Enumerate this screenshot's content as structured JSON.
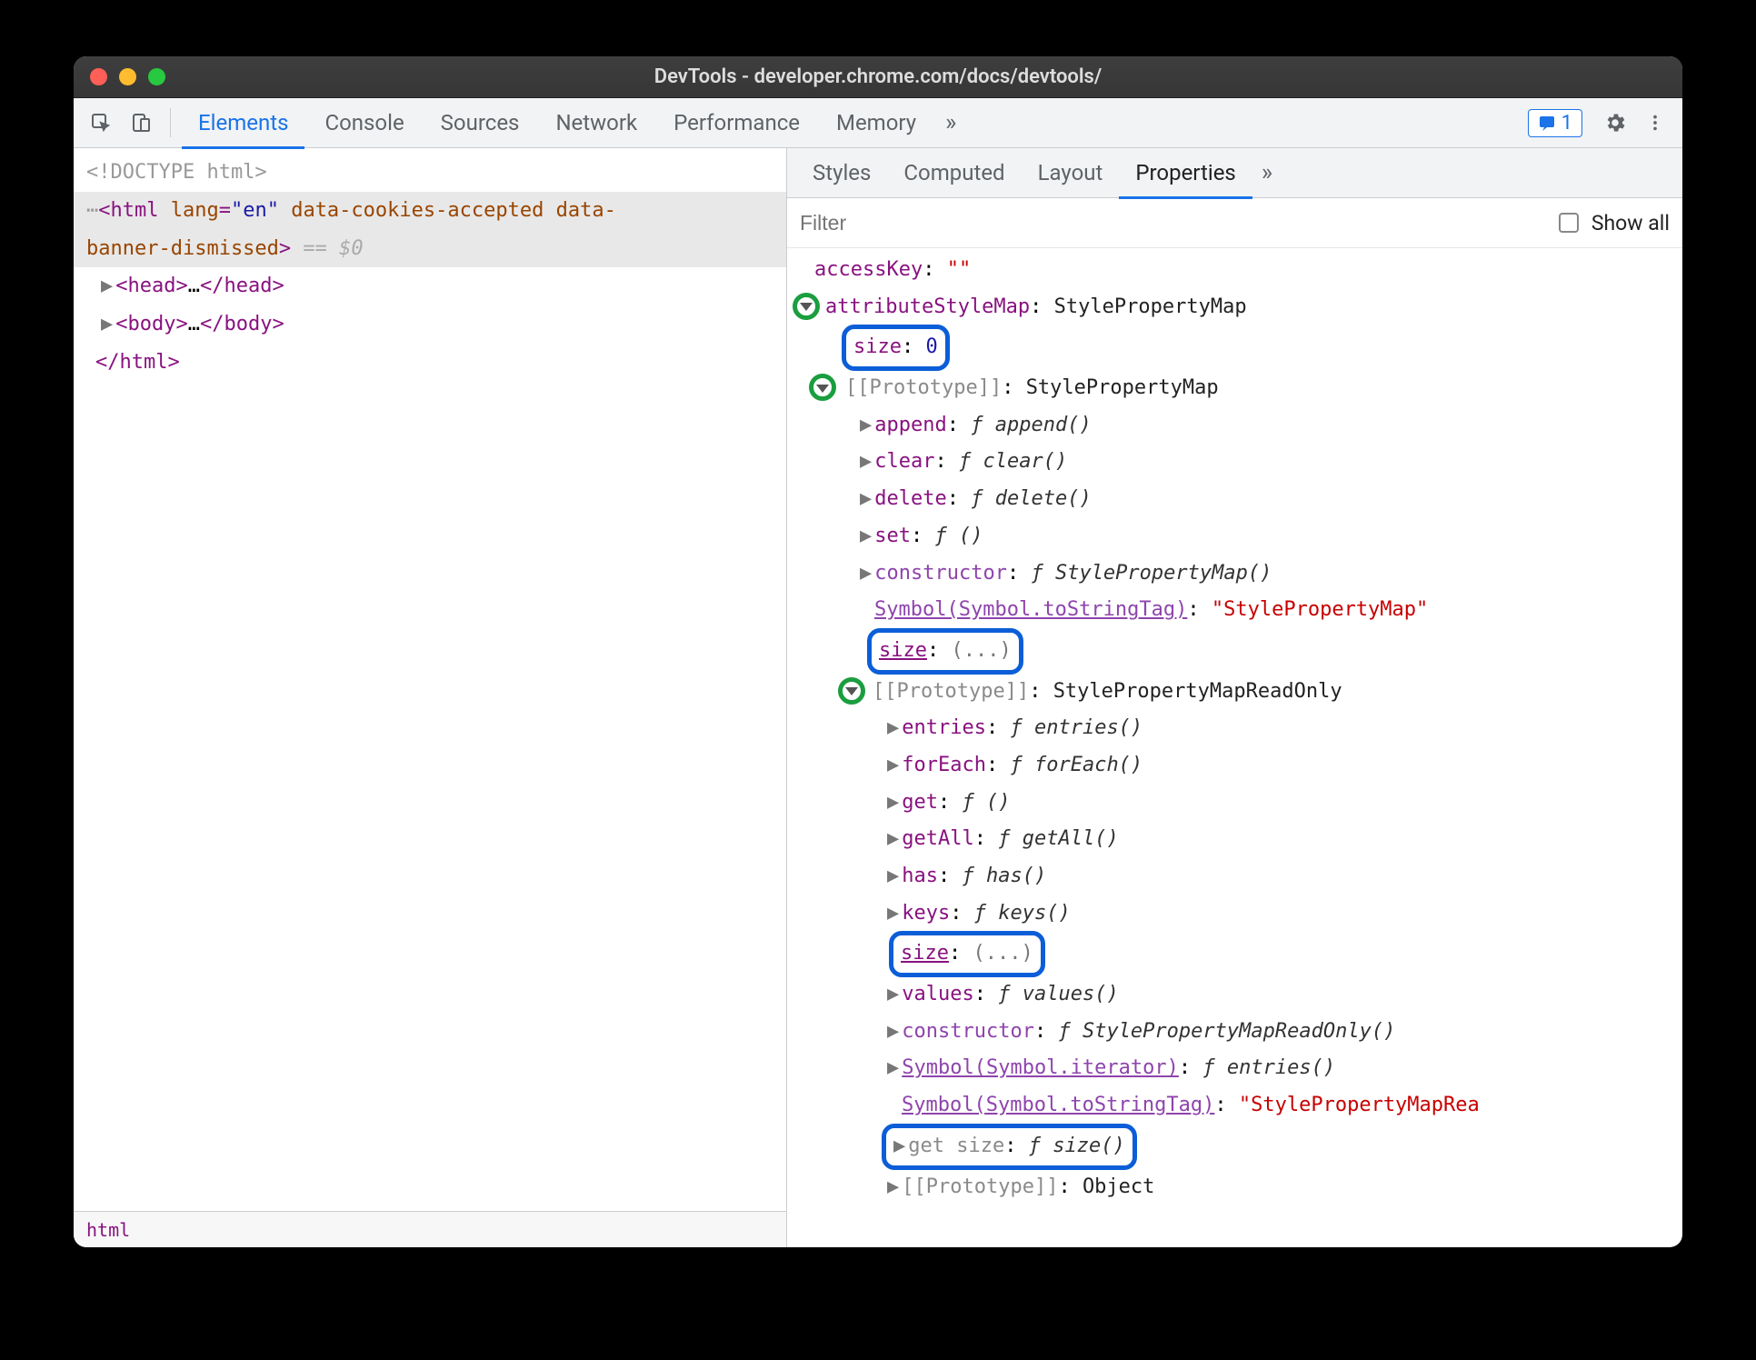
{
  "window": {
    "title": "DevTools - developer.chrome.com/docs/devtools/"
  },
  "toolbar": {
    "tabs": [
      "Elements",
      "Console",
      "Sources",
      "Network",
      "Performance",
      "Memory"
    ],
    "active_tab": "Elements",
    "issues_count": "1"
  },
  "dom": {
    "doctype": "<!DOCTYPE html>",
    "html_open_1": "<html lang=\"en\" data-cookies-accepted data-",
    "html_open_2": "banner-dismissed>",
    "eq0": "== $0",
    "head": "<head>…</head>",
    "body": "<body>…</body>",
    "html_close": "</html>",
    "breadcrumb": "html"
  },
  "subtabs": {
    "tabs": [
      "Styles",
      "Computed",
      "Layout",
      "Properties"
    ],
    "active": "Properties"
  },
  "filter": {
    "placeholder": "Filter",
    "showall_label": "Show all"
  },
  "props": {
    "accessKey": {
      "k": "accessKey",
      "v": "\"\""
    },
    "attrStyleMap": {
      "k": "attributeStyleMap",
      "v": "StylePropertyMap"
    },
    "size0": {
      "k": "size",
      "v": "0"
    },
    "proto1": {
      "k": "[[Prototype]]",
      "v": "StylePropertyMap"
    },
    "append": {
      "k": "append",
      "fn": "append()"
    },
    "clear": {
      "k": "clear",
      "fn": "clear()"
    },
    "delete": {
      "k": "delete",
      "fn": "delete()"
    },
    "set": {
      "k": "set",
      "fn": "()"
    },
    "ctor1": {
      "k": "constructor",
      "fn": "StylePropertyMap()"
    },
    "stt1": {
      "k": "Symbol(Symbol.toStringTag)",
      "v": "\"StylePropertyMap\""
    },
    "size1": {
      "k": "size",
      "v": "(...)"
    },
    "proto2": {
      "k": "[[Prototype]]",
      "v": "StylePropertyMapReadOnly"
    },
    "entries": {
      "k": "entries",
      "fn": "entries()"
    },
    "forEach": {
      "k": "forEach",
      "fn": "forEach()"
    },
    "get": {
      "k": "get",
      "fn": "()"
    },
    "getAll": {
      "k": "getAll",
      "fn": "getAll()"
    },
    "has": {
      "k": "has",
      "fn": "has()"
    },
    "keys": {
      "k": "keys",
      "fn": "keys()"
    },
    "size2": {
      "k": "size",
      "v": "(...)"
    },
    "values": {
      "k": "values",
      "fn": "values()"
    },
    "ctor2": {
      "k": "constructor",
      "fn": "StylePropertyMapReadOnly()"
    },
    "symIter": {
      "k": "Symbol(Symbol.iterator)",
      "fn": "entries()"
    },
    "stt2": {
      "k": "Symbol(Symbol.toStringTag)",
      "v": "\"StylePropertyMapRea"
    },
    "getsize": {
      "k": "get size",
      "fn": "size()"
    },
    "proto3": {
      "k": "[[Prototype]]",
      "v": "Object"
    }
  }
}
